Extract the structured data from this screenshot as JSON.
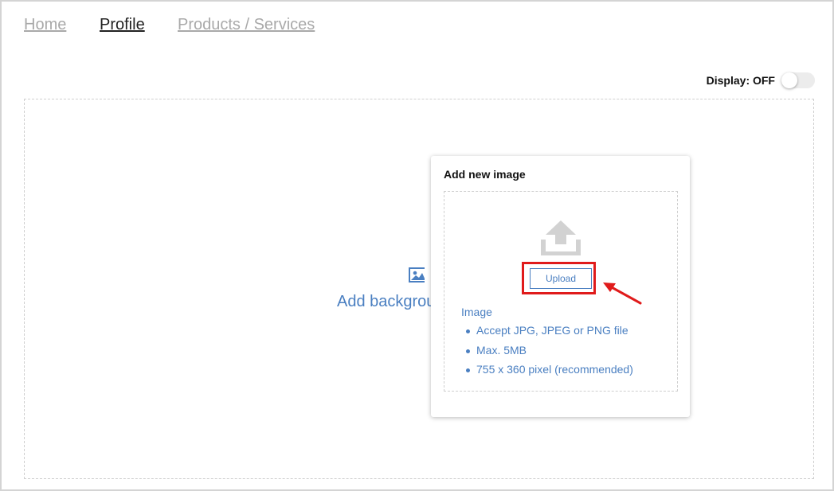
{
  "nav": {
    "items": [
      {
        "label": "Home",
        "active": false
      },
      {
        "label": "Profile",
        "active": true
      },
      {
        "label": "Products / Services",
        "active": false
      }
    ]
  },
  "display": {
    "label": "Display: OFF",
    "toggle_on": false
  },
  "background": {
    "label": "Add backgrou",
    "icon": "image-icon"
  },
  "popup": {
    "title": "Add new image",
    "icon": "upload-icon",
    "upload_button": "Upload",
    "requirements_title": "Image",
    "requirements": [
      "Accept JPG, JPEG or PNG file",
      "Max. 5MB",
      "755 x 360 pixel (recommended)"
    ]
  },
  "colors": {
    "accent": "#4a7fc1",
    "highlight": "#e01b1b",
    "nav_inactive": "#a9a9a9",
    "nav_active": "#222222"
  }
}
